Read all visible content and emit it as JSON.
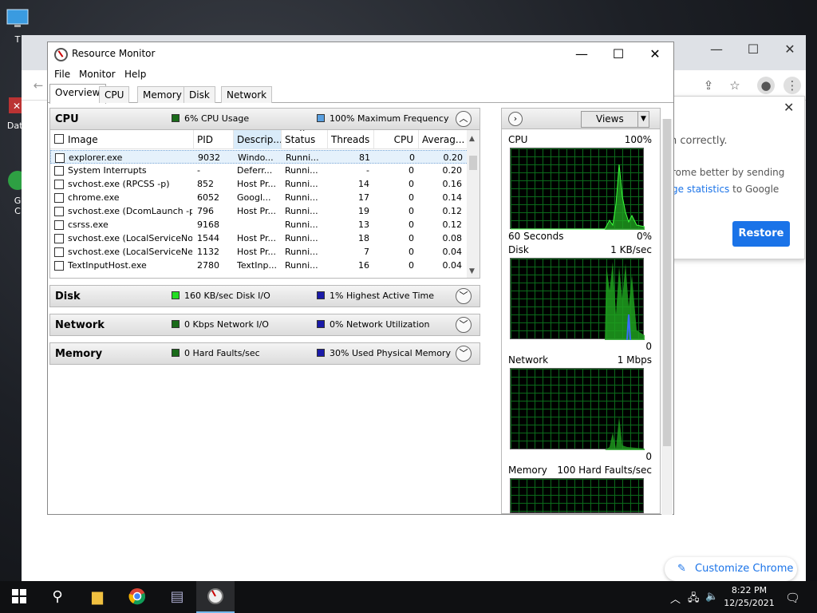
{
  "desktop": {
    "icons": [
      {
        "label": "T",
        "name": "this-pc-icon"
      },
      {
        "label": "Data",
        "name": "data-icon"
      },
      {
        "label": "G\nC",
        "name": "google-chrome-desktop-icon"
      }
    ]
  },
  "chrome_bg": {
    "restore_msg_1": "n correctly.",
    "restore_msg_2": "rome better by sending",
    "restore_msg_3a": "ge statistics",
    "restore_msg_3b": " to Google",
    "restore_button": "Restore",
    "customize_label": "Customize Chrome"
  },
  "window": {
    "title": "Resource Monitor",
    "menu": [
      "File",
      "Monitor",
      "Help"
    ],
    "tabs": [
      "Overview",
      "CPU",
      "Memory",
      "Disk",
      "Network"
    ],
    "active_tab": "Overview"
  },
  "cpu_section": {
    "name": "CPU",
    "indicator1": "6% CPU Usage",
    "indicator1_color": "#1a6b1a",
    "indicator2": "100% Maximum Frequency",
    "indicator2_color": "#5aa0e0",
    "columns": [
      "Image",
      "PID",
      "Descrip...",
      "Status",
      "Threads",
      "CPU",
      "Averag..."
    ],
    "rows": [
      {
        "image": "explorer.exe",
        "pid": "9032",
        "desc": "Windo...",
        "status": "Runni...",
        "threads": "81",
        "cpu": "0",
        "avg": "0.20"
      },
      {
        "image": "System Interrupts",
        "pid": "-",
        "desc": "Deferr...",
        "status": "Runni...",
        "threads": "-",
        "cpu": "0",
        "avg": "0.20"
      },
      {
        "image": "svchost.exe (RPCSS -p)",
        "pid": "852",
        "desc": "Host Pr...",
        "status": "Runni...",
        "threads": "14",
        "cpu": "0",
        "avg": "0.16"
      },
      {
        "image": "chrome.exe",
        "pid": "6052",
        "desc": "Googl...",
        "status": "Runni...",
        "threads": "17",
        "cpu": "0",
        "avg": "0.14"
      },
      {
        "image": "svchost.exe (DcomLaunch -p)",
        "pid": "796",
        "desc": "Host Pr...",
        "status": "Runni...",
        "threads": "19",
        "cpu": "0",
        "avg": "0.12"
      },
      {
        "image": "csrss.exe",
        "pid": "9168",
        "desc": "",
        "status": "Runni...",
        "threads": "13",
        "cpu": "0",
        "avg": "0.12"
      },
      {
        "image": "svchost.exe (LocalServiceNo...",
        "pid": "1544",
        "desc": "Host Pr...",
        "status": "Runni...",
        "threads": "18",
        "cpu": "0",
        "avg": "0.08"
      },
      {
        "image": "svchost.exe (LocalServiceNet...",
        "pid": "1132",
        "desc": "Host Pr...",
        "status": "Runni...",
        "threads": "7",
        "cpu": "0",
        "avg": "0.04"
      },
      {
        "image": "TextInputHost.exe",
        "pid": "2780",
        "desc": "TextInp...",
        "status": "Runni...",
        "threads": "16",
        "cpu": "0",
        "avg": "0.04"
      }
    ]
  },
  "disk_section": {
    "name": "Disk",
    "indicator1": "160 KB/sec Disk I/O",
    "indicator1_color": "#22dd22",
    "indicator2": "1% Highest Active Time",
    "indicator2_color": "#1a1aa8"
  },
  "network_section": {
    "name": "Network",
    "indicator1": "0 Kbps Network I/O",
    "indicator1_color": "#1a6b1a",
    "indicator2": "0% Network Utilization",
    "indicator2_color": "#1a1aa8"
  },
  "memory_section": {
    "name": "Memory",
    "indicator1": "0 Hard Faults/sec",
    "indicator1_color": "#1a6b1a",
    "indicator2": "30% Used Physical Memory",
    "indicator2_color": "#1a1aa8"
  },
  "right_pane": {
    "views_label": "Views",
    "graphs": [
      {
        "title": "CPU",
        "max": "100%",
        "footer_left": "60 Seconds",
        "footer_right": "0%"
      },
      {
        "title": "Disk",
        "max": "1 KB/sec",
        "footer_left": "",
        "footer_right": "0"
      },
      {
        "title": "Network",
        "max": "1 Mbps",
        "footer_left": "",
        "footer_right": "0"
      },
      {
        "title": "Memory",
        "max": "100 Hard Faults/sec",
        "footer_left": "",
        "footer_right": ""
      }
    ]
  },
  "taskbar": {
    "time": "8:22 PM",
    "date": "12/25/2021"
  }
}
